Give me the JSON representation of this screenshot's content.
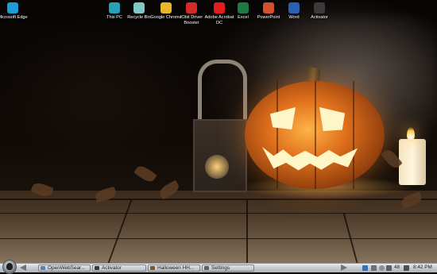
{
  "desktop": {
    "icons": [
      {
        "label": "Microsoft Edge",
        "icon": "edge-icon",
        "color": "#1f9bd8"
      },
      {
        "label": "This PC",
        "icon": "computer-icon",
        "color": "#2a9fb8"
      },
      {
        "label": "Recycle Bin",
        "icon": "recycle-bin-icon",
        "color": "#7fc9c4"
      },
      {
        "label": "Google Chrome",
        "icon": "chrome-icon",
        "color": "#e8b62c"
      },
      {
        "label": "IObit Driver Booster",
        "icon": "driver-booster-icon",
        "color": "#d32a2a"
      },
      {
        "label": "Adobe Acrobat DC",
        "icon": "acrobat-icon",
        "color": "#e01e1e"
      },
      {
        "label": "Excel",
        "icon": "excel-icon",
        "color": "#1e7a44"
      },
      {
        "label": "PowerPoint",
        "icon": "powerpoint-icon",
        "color": "#d2502c"
      },
      {
        "label": "Word",
        "icon": "word-icon",
        "color": "#2b5fb4"
      },
      {
        "label": "Activator",
        "icon": "activator-icon",
        "color": "#3a3a3a"
      }
    ]
  },
  "taskbar": {
    "start_icon": "skull-start-icon",
    "tasks": [
      {
        "label": "OpenWebSear...",
        "icon": "browser-icon",
        "color": "#5a7fb0"
      },
      {
        "label": "Activator",
        "icon": "activator-icon",
        "color": "#3a3a3a"
      },
      {
        "label": "Halloween HH...",
        "icon": "image-viewer-icon",
        "color": "#7a5a2a"
      },
      {
        "label": "Settings",
        "icon": "gear-icon",
        "color": "#5a6068"
      }
    ],
    "tray": {
      "volume_level": "48",
      "clock": "8:42 PM"
    },
    "accent": "#c8cdd2"
  }
}
